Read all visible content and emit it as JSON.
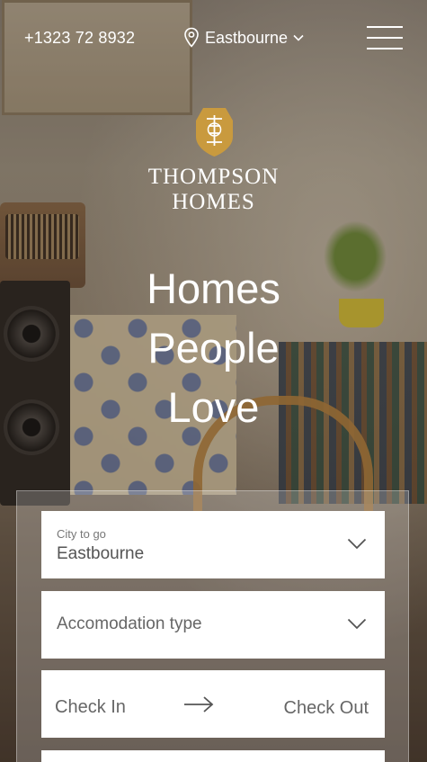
{
  "header": {
    "phone": "+1323 72 8932",
    "location": "Eastbourne"
  },
  "brand": {
    "line1": "Thompson",
    "line2": "Homes",
    "accent_color": "#c99a3e"
  },
  "hero": {
    "headline_lines": [
      "Homes",
      "People",
      "Love"
    ]
  },
  "search_form": {
    "city": {
      "label": "City to go",
      "value": "Eastbourne"
    },
    "accommodation": {
      "placeholder": "Accomodation type"
    },
    "dates": {
      "check_in": "Check In",
      "check_out": "Check Out"
    }
  },
  "icons": {
    "location": "map-pin-icon",
    "menu": "hamburger-menu-icon",
    "chevron": "chevron-down-icon",
    "arrow": "arrow-right-icon"
  }
}
